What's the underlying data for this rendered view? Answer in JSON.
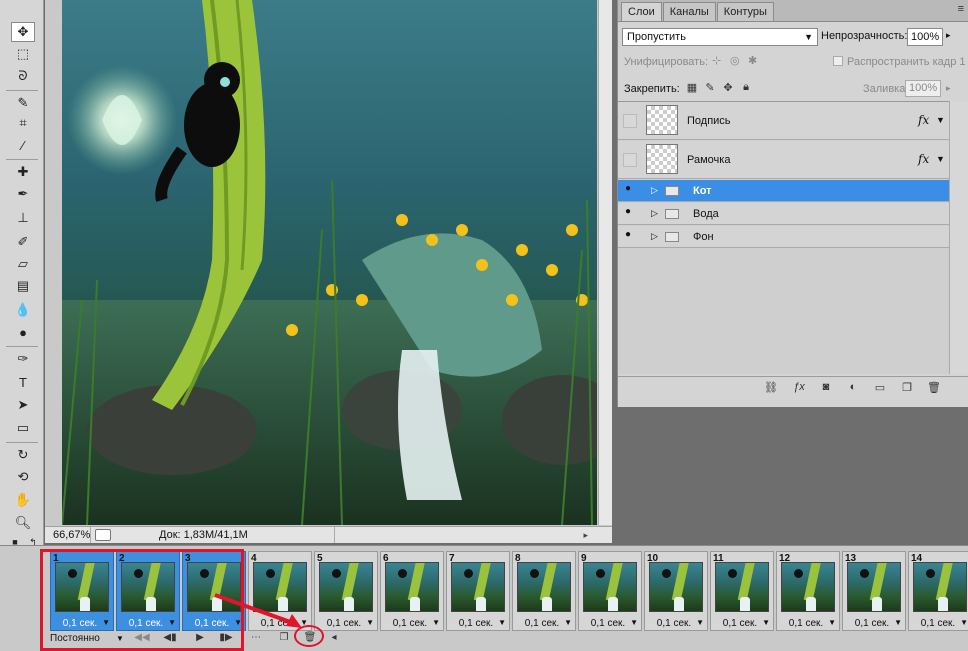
{
  "document": {
    "zoom": "66,67%",
    "doc_size": "Док: 1,83M/41,1M"
  },
  "layers_panel": {
    "tabs": [
      "Слои",
      "Каналы",
      "Контуры"
    ],
    "blend_mode": "Пропустить",
    "opacity_label": "Непрозрачность:",
    "opacity_value": "100%",
    "unify_label": "Унифицировать:",
    "propagate_label": "Распространить кадр 1",
    "lock_label": "Закрепить:",
    "fill_label": "Заливка:",
    "fill_value": "100%",
    "layers": [
      {
        "name": "Подпись",
        "type": "layer",
        "visible": false,
        "fx": "fx"
      },
      {
        "name": "Рамочка",
        "type": "layer",
        "visible": false,
        "fx": "fx"
      },
      {
        "name": "Кот",
        "type": "group",
        "visible": true,
        "selected": true
      },
      {
        "name": "Вода",
        "type": "group",
        "visible": true
      },
      {
        "name": "Фон",
        "type": "group",
        "visible": true
      }
    ]
  },
  "animation": {
    "loop": "Постоянно",
    "frames": [
      {
        "n": "1",
        "delay": "0,1 сек.",
        "selected": true
      },
      {
        "n": "2",
        "delay": "0,1 сек.",
        "selected": true
      },
      {
        "n": "3",
        "delay": "0,1 сек.",
        "selected": true
      },
      {
        "n": "4",
        "delay": "0,1 сек."
      },
      {
        "n": "5",
        "delay": "0,1 сек."
      },
      {
        "n": "6",
        "delay": "0,1 сек."
      },
      {
        "n": "7",
        "delay": "0,1 сек."
      },
      {
        "n": "8",
        "delay": "0,1 сек."
      },
      {
        "n": "9",
        "delay": "0,1 сек."
      },
      {
        "n": "10",
        "delay": "0,1 сек."
      },
      {
        "n": "11",
        "delay": "0,1 сек."
      },
      {
        "n": "12",
        "delay": "0,1 сек."
      },
      {
        "n": "13",
        "delay": "0,1 сек."
      },
      {
        "n": "14",
        "delay": "0,1 сек."
      }
    ]
  },
  "colors": {
    "selection_blue": "#3a8ee6",
    "annotation_red": "#e0142a"
  }
}
